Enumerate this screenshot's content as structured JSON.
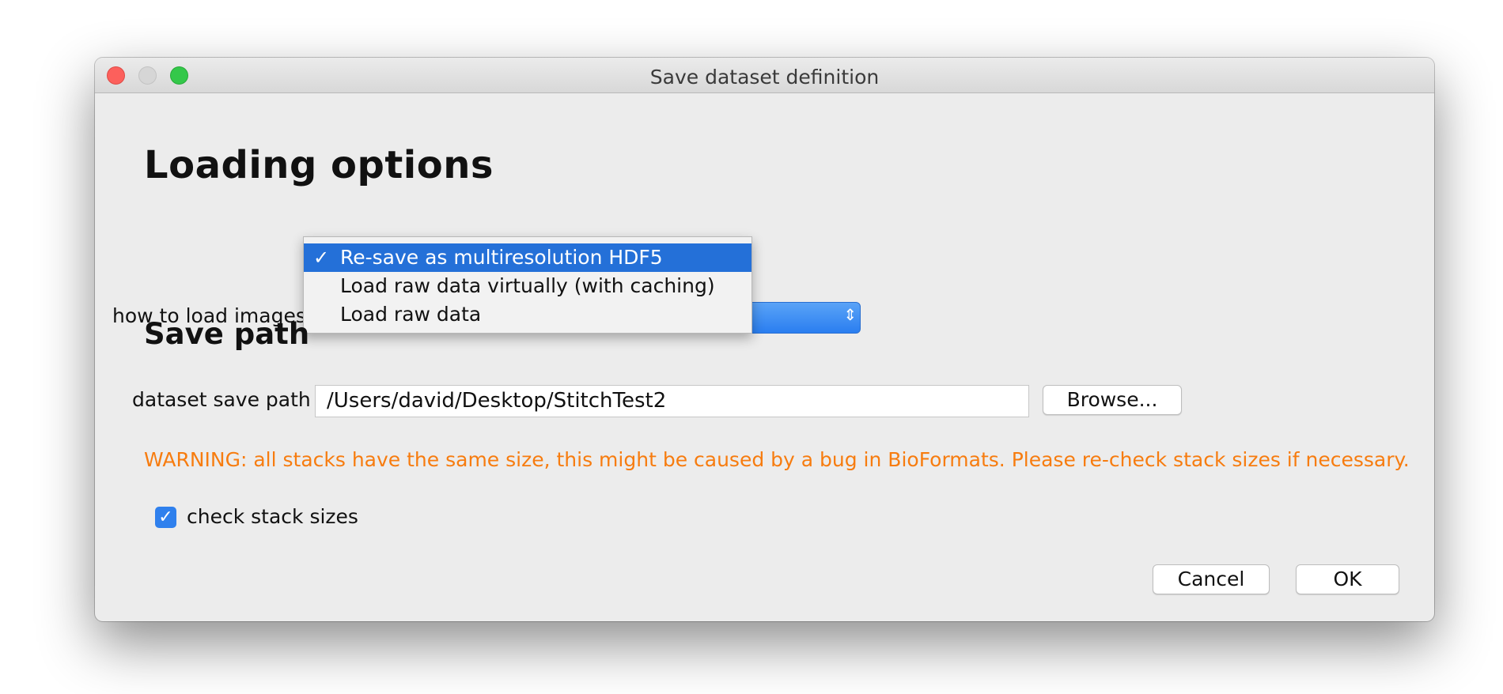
{
  "window": {
    "title": "Save dataset definition"
  },
  "loading_options": {
    "heading": "Loading options",
    "load_label": "how to load images",
    "dropdown": {
      "selected_check": "✓",
      "options": [
        "Re-save as multiresolution HDF5",
        "Load raw data virtually (with caching)",
        "Load raw data"
      ],
      "selected_index": 0
    }
  },
  "save_path": {
    "heading": "Save path",
    "label": "dataset save path",
    "value": "/Users/david/Desktop/StitchTest2",
    "browse_label": "Browse..."
  },
  "warning": "WARNING: all stacks have the same size, this might be caused by a bug in BioFormats. Please re-check stack sizes if necessary.",
  "check_stack_sizes": {
    "label": "check stack sizes",
    "checked": true,
    "checkmark": "✓"
  },
  "buttons": {
    "cancel": "Cancel",
    "ok": "OK"
  },
  "colors": {
    "warning": "#f77c0f",
    "selection": "#2470d8",
    "close_button": "#fc605c",
    "zoom_button": "#34c84a",
    "checkbox": "#2f80ed"
  },
  "icons": {
    "combo_arrow": "up-down-chevron-icon"
  }
}
